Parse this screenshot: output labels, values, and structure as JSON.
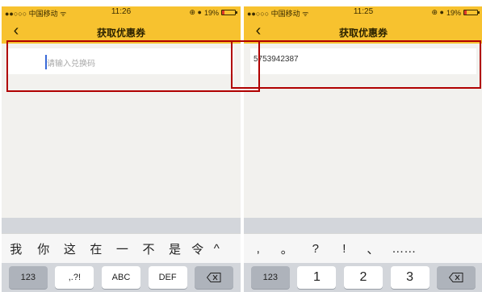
{
  "status_left": {
    "carrier": "●●○○○ 中国移动 ᯤ",
    "time": "11:26",
    "battery": "19%"
  },
  "status_right": {
    "carrier": "●●○○○ 中国移动 ᯤ",
    "time": "11:25",
    "battery": "19%"
  },
  "nav": {
    "title": "获取优惠券"
  },
  "left_input": {
    "placeholder": "请输入兑换码"
  },
  "right_input": {
    "value": "5753942387"
  },
  "left_keyboard": {
    "candidates": [
      "我",
      "你",
      "这",
      "在",
      "一",
      "不",
      "是",
      "令",
      "^"
    ],
    "keys": [
      "123",
      ",.?!",
      "ABC",
      "DEF"
    ]
  },
  "right_keyboard": {
    "candidates": [
      ",",
      "。",
      "?",
      "!",
      "、",
      "……"
    ],
    "keys": [
      "123",
      "1",
      "2",
      "3"
    ]
  },
  "colors": {
    "header": "#f7c22f",
    "highlight": "#b00000",
    "cursor": "#3a6ad8"
  },
  "icons": {
    "back": "chevron-left-icon",
    "delete": "backspace-icon",
    "collapse": "chevron-up-icon"
  }
}
